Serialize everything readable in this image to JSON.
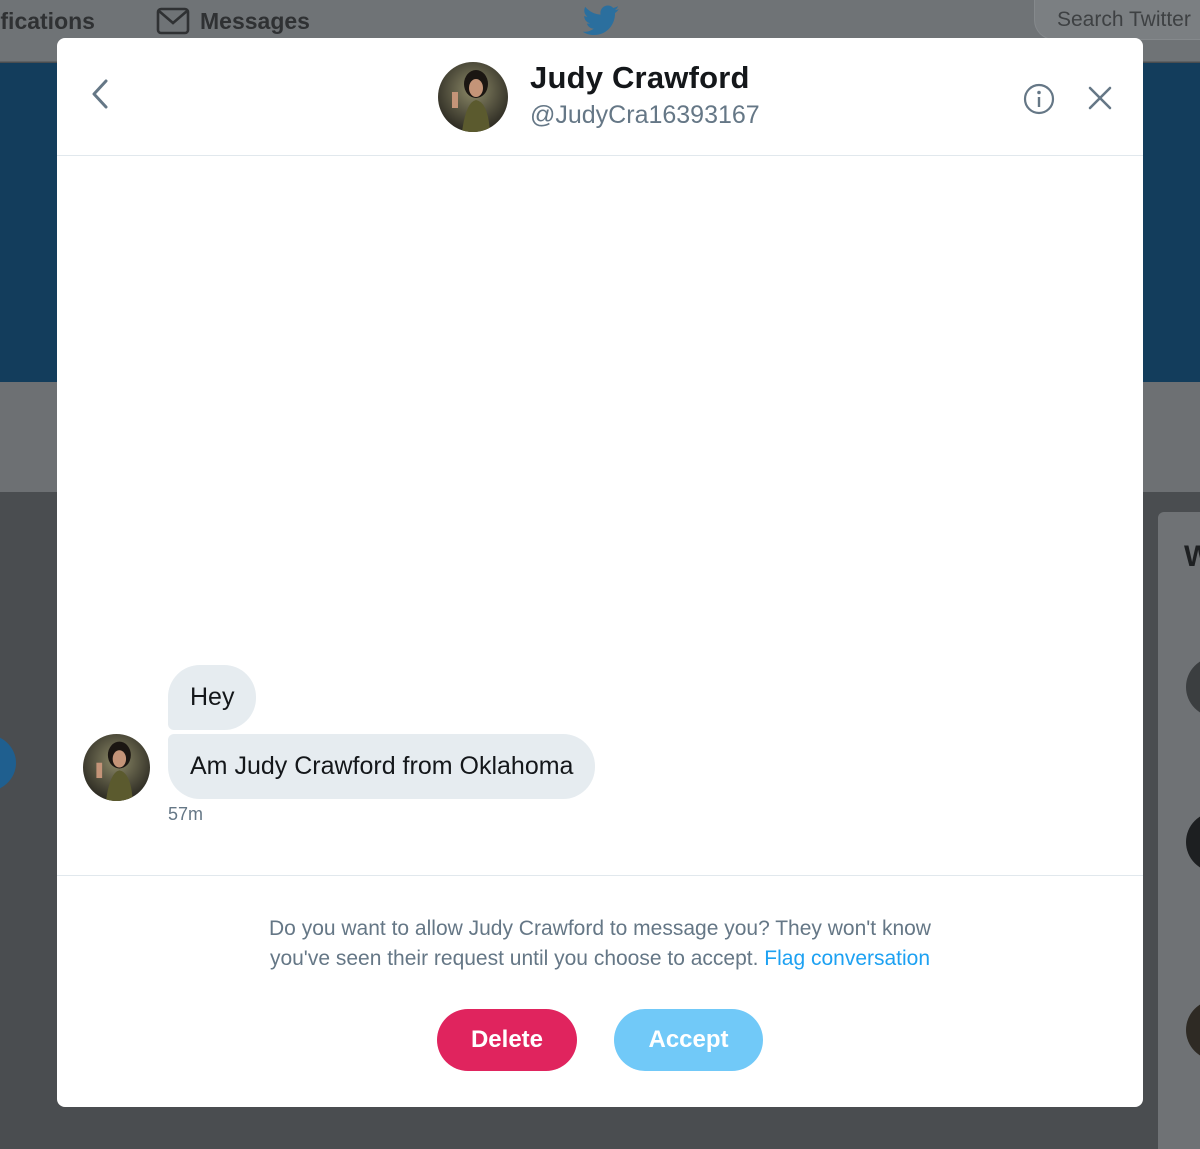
{
  "background": {
    "nav": {
      "notifications_label": "ifications",
      "messages_label": "Messages",
      "search_placeholder": "Search Twitter",
      "logo_icon": "twitter-bird-icon",
      "messages_icon": "envelope-icon"
    },
    "side_card_letter": "W"
  },
  "dialog": {
    "header": {
      "name": "Judy Crawford",
      "handle": "@JudyCra16393167",
      "back_icon": "chevron-left-icon",
      "info_icon": "info-circle-icon",
      "close_icon": "close-icon"
    },
    "messages": [
      {
        "text": "Hey"
      },
      {
        "text": "Am Judy Crawford from Oklahoma"
      }
    ],
    "timestamp": "57m",
    "request": {
      "line1": "Do you want to allow Judy Crawford to message you? They won't know",
      "line2": "you've seen their request until you choose to accept.",
      "flag_link": "Flag conversation"
    },
    "actions": {
      "delete_label": "Delete",
      "accept_label": "Accept"
    }
  },
  "colors": {
    "delete": "#e0245e",
    "accept": "#71c9f8",
    "link": "#1da1f2",
    "bubble": "#e6ecf0",
    "banner": "#133d5c"
  }
}
